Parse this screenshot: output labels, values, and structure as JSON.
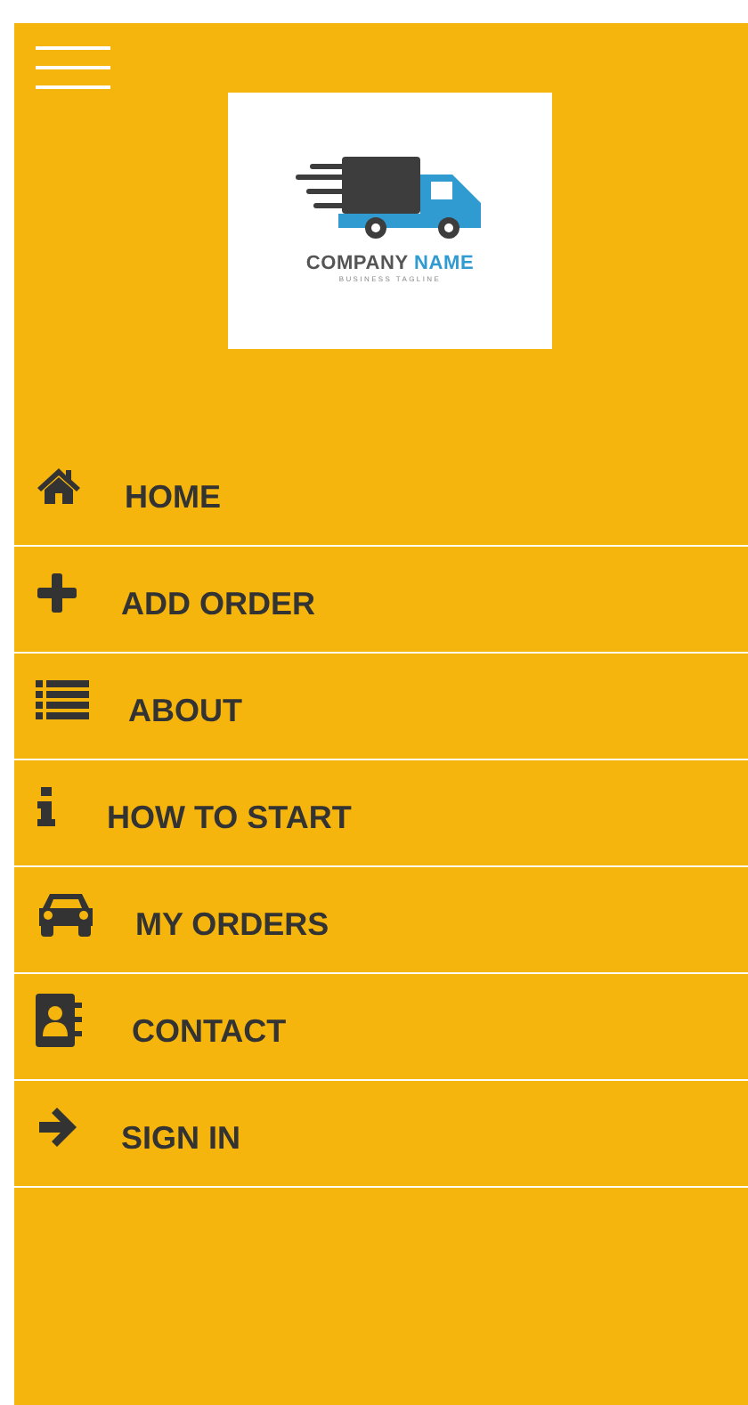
{
  "logo": {
    "name_dark": "COMPANY",
    "name_light": "NAME",
    "tagline": "BUSINESS TAGLINE"
  },
  "menu": [
    {
      "label": "HOME",
      "kind": "home"
    },
    {
      "label": "ADD ORDER",
      "kind": "plus"
    },
    {
      "label": "ABOUT",
      "kind": "list"
    },
    {
      "label": "HOW TO START",
      "kind": "info"
    },
    {
      "label": "MY ORDERS",
      "kind": "car"
    },
    {
      "label": "CONTACT",
      "kind": "contact"
    },
    {
      "label": "SIGN IN",
      "kind": "arrow"
    }
  ]
}
